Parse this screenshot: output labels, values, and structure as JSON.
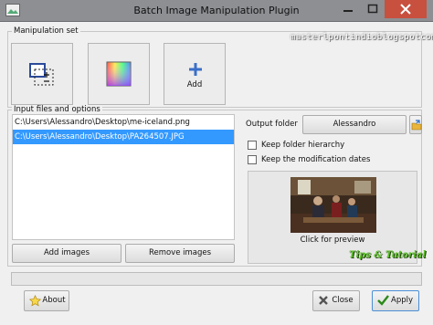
{
  "window": {
    "title": "Batch Image Manipulation Plugin",
    "watermark": "masterlpontindioblogspotcom",
    "badge": "Tips & Tutorial"
  },
  "manipulation": {
    "group_label": "Manipulation set",
    "add_label": "Add"
  },
  "input": {
    "group_label": "Input files and options",
    "files": [
      "C:\\Users\\Alessandro\\Desktop\\me-iceland.png",
      "C:\\Users\\Alessandro\\Desktop\\PA264507.JPG"
    ],
    "selected_index": 1,
    "add_images": "Add images",
    "remove_images": "Remove images",
    "output_label": "Output folder",
    "output_value": "Alessandro",
    "keep_hierarchy": "Keep folder hierarchy",
    "keep_dates": "Keep the modification dates",
    "preview_label": "Click for preview"
  },
  "footer": {
    "about": "About",
    "close": "Close",
    "apply": "Apply"
  },
  "colors": {
    "selection": "#3399ff",
    "close_button": "#c7503f",
    "badge": "#5bbf2a"
  }
}
